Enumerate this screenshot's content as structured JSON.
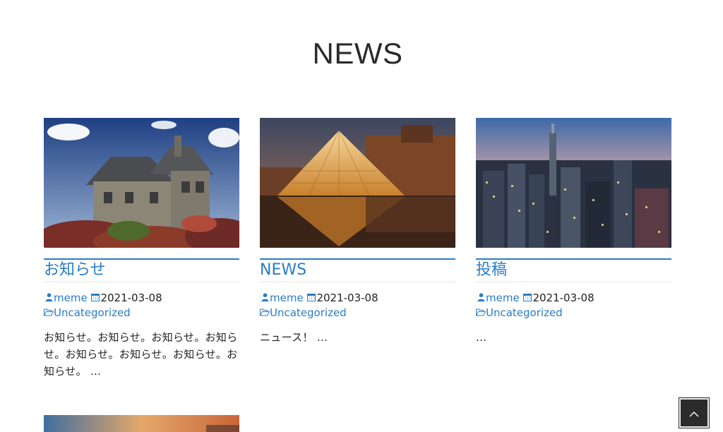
{
  "section": {
    "title": "NEWS"
  },
  "posts": [
    {
      "title": "お知らせ",
      "author": "meme",
      "date": "2021-03-08",
      "category": "Uncategorized",
      "excerpt": "お知らせ。お知らせ。お知らせ。お知らせ。お知らせ。お知らせ。お知らせ。お知らせ。 ...",
      "image": "house-photo"
    },
    {
      "title": "NEWS",
      "author": "meme",
      "date": "2021-03-08",
      "category": "Uncategorized",
      "excerpt": "ニュース！ ...",
      "image": "louvre-pyramid-photo"
    },
    {
      "title": "投稿",
      "author": "meme",
      "date": "2021-03-08",
      "category": "Uncategorized",
      "excerpt": "...",
      "image": "city-skyline-photo"
    }
  ],
  "icons": {
    "author": "user-icon",
    "date": "calendar-icon",
    "category": "folder-open-icon",
    "back_to_top": "chevron-up-icon"
  },
  "colors": {
    "accent": "#2a7cc5",
    "text": "#222222",
    "button_bg": "#2b2b2b"
  }
}
